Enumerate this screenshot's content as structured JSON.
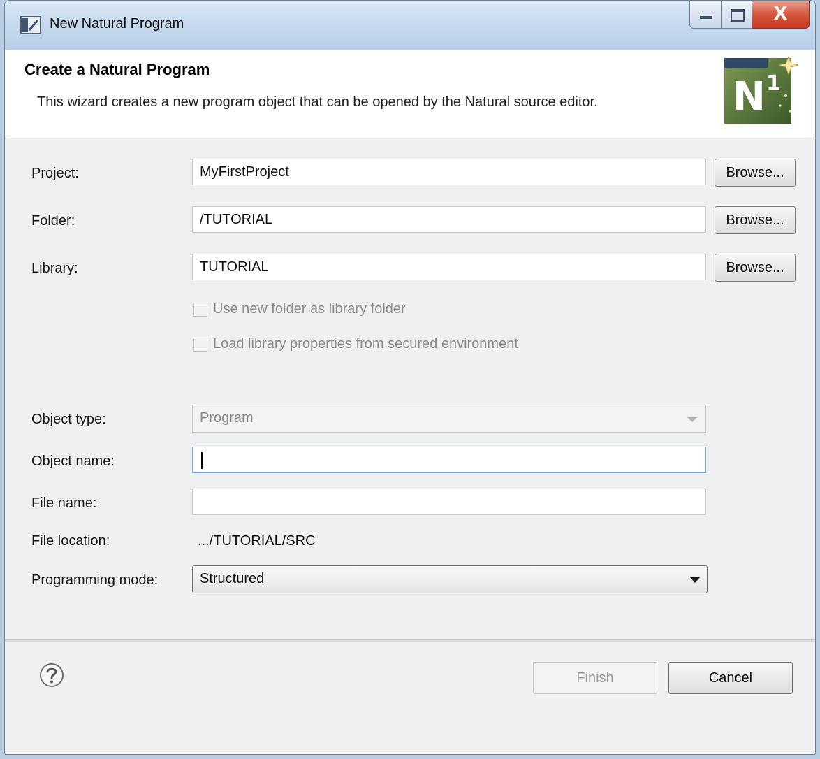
{
  "window": {
    "title": "New Natural Program",
    "controls": {
      "minimize_icon": "minimize-icon",
      "maximize_icon": "maximize-icon",
      "close_label": "X"
    }
  },
  "banner": {
    "title": "Create a Natural Program",
    "description": "This wizard creates a new program object that can be opened by the Natural source editor.",
    "logo_icon": "natural-n1-wizard-icon"
  },
  "form": {
    "project": {
      "label": "Project:",
      "value": "MyFirstProject",
      "browse": "Browse..."
    },
    "folder": {
      "label": "Folder:",
      "value": "/TUTORIAL",
      "browse": "Browse..."
    },
    "library": {
      "label": "Library:",
      "value": "TUTORIAL",
      "browse": "Browse..."
    },
    "use_new_folder": {
      "label": "Use new folder as library folder",
      "checked": false,
      "enabled": false
    },
    "load_library_props": {
      "label": "Load library properties from secured environment",
      "checked": false,
      "enabled": false
    },
    "object_type": {
      "label": "Object type:",
      "value": "Program",
      "enabled": false
    },
    "object_name": {
      "label": "Object name:",
      "value": ""
    },
    "file_name": {
      "label": "File name:",
      "value": ""
    },
    "file_location": {
      "label": "File location:",
      "value": ".../TUTORIAL/SRC"
    },
    "programming_mode": {
      "label": "Programming mode:",
      "value": "Structured"
    }
  },
  "footer": {
    "help_icon": "help-question-icon",
    "finish": "Finish",
    "cancel": "Cancel"
  },
  "colors": {
    "titlebar": "#c7daef",
    "close_button": "#d5573d",
    "dialog_background": "#f0f0f0",
    "banner_background": "#ffffff",
    "disabled_text": "#8b8b8b"
  }
}
